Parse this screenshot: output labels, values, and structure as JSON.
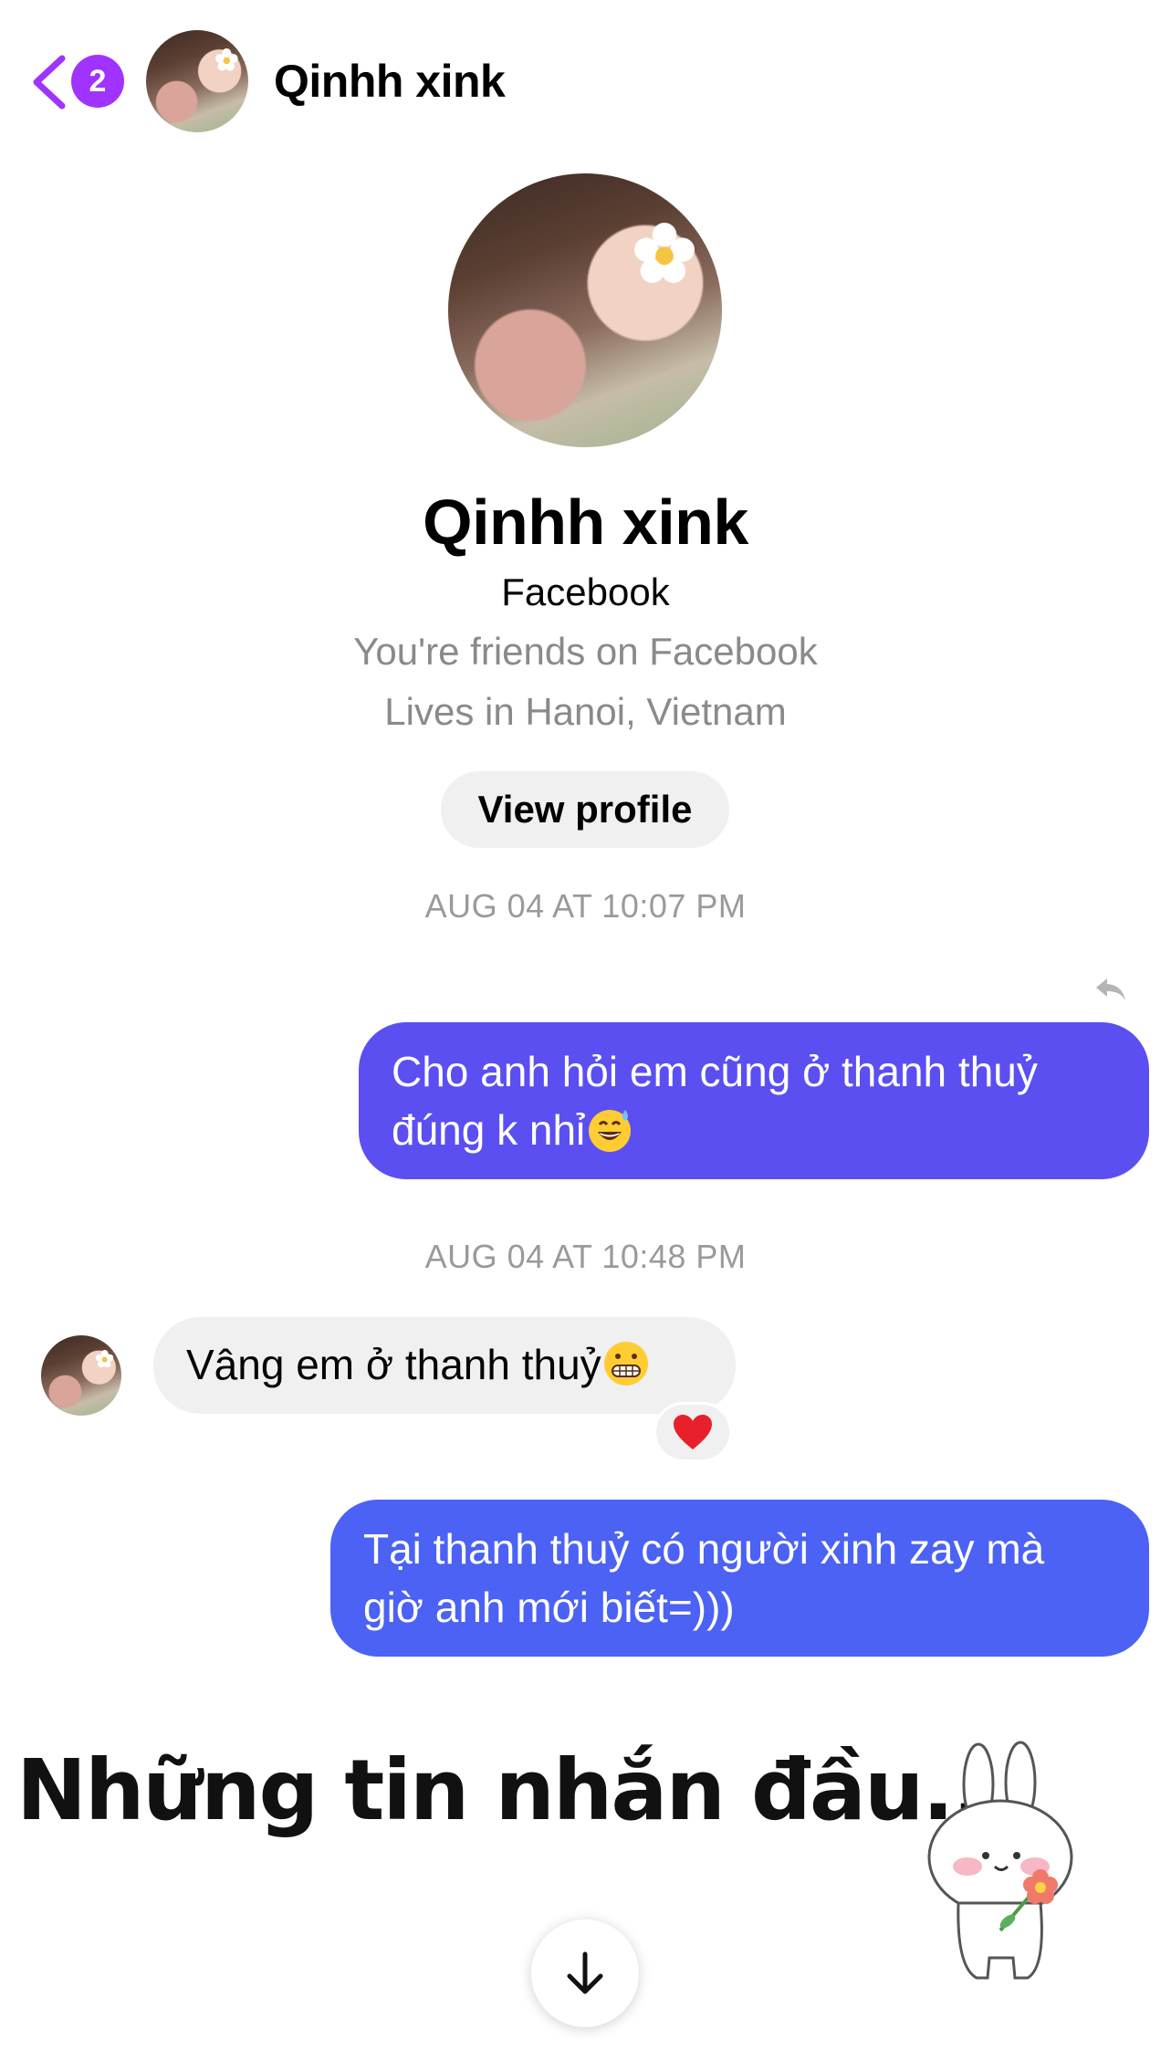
{
  "header": {
    "back_label": "",
    "unread_count": "2",
    "contact_name": "Qinhh xink"
  },
  "profile": {
    "name": "Qinhh xink",
    "source": "Facebook",
    "friends_line": "You're friends on Facebook",
    "location_line": "Lives in Hanoi, Vietnam",
    "view_profile_label": "View profile"
  },
  "messages": [
    {
      "timestamp": "AUG 04 AT 10:07 PM"
    },
    {
      "direction": "outgoing",
      "line1": "Cho anh hỏi em cũng ở thanh thuỷ",
      "line2": "đúng k nhỉ",
      "emoji": "grinning-sweat-emoji"
    },
    {
      "timestamp": "AUG 04 AT 10:48 PM"
    },
    {
      "direction": "incoming",
      "text": "Vâng em ở thanh thuỷ",
      "emoji": "grimacing-emoji",
      "reaction": "red-heart-emoji"
    },
    {
      "direction": "outgoing",
      "line1": "Tại thanh thuỷ có người xinh zay mà",
      "line2": "giờ anh mới biết=)))"
    }
  ],
  "overlay": {
    "caption": "Những tin nhắn đầu..."
  },
  "colors": {
    "accent_purple": "#a033ff",
    "outgoing_bubble_1": "#5b4ff2",
    "outgoing_bubble_2": "#4b62f5",
    "incoming_bubble": "#f0f0f0",
    "muted_text": "#8a8a8a"
  },
  "icons": [
    "chevron-left-icon",
    "reply-icon",
    "arrow-down-icon",
    "red-heart-emoji",
    "bunny-sticker"
  ]
}
